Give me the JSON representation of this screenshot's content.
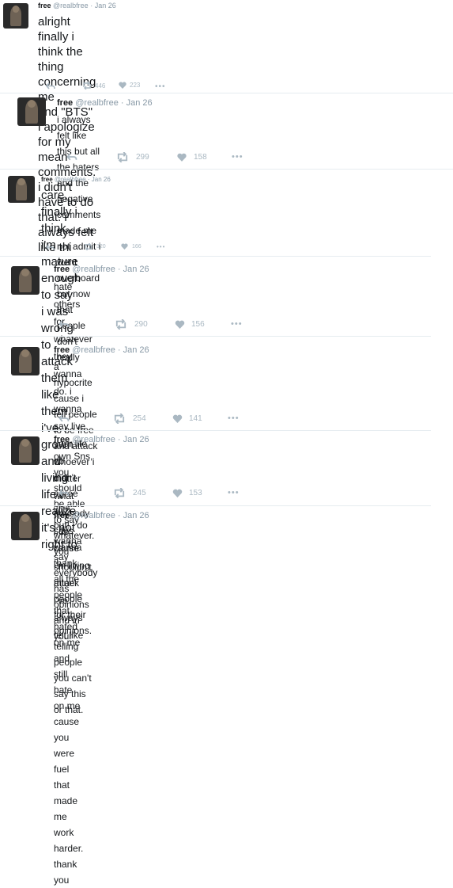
{
  "tweets": [
    {
      "name": "free",
      "handle": "@realbfree",
      "date": "Jan 26",
      "lines": [
        "alright finally i think the thing concerning me",
        "and \"BTS\"",
        "i apologize for my mean comments. i didn't",
        "have to do that. i always felt like thi"
      ],
      "retweets": "446",
      "likes": "223"
    },
    {
      "name": "free",
      "handle": "@realbfree",
      "date": "Jan 26",
      "lines": [
        "i always felt like this but all the haters and the negative comments",
        "made me not admit i went overboard but now that people don't really"
      ],
      "retweets": "299",
      "likes": "158"
    },
    {
      "name": "free",
      "handle": "@realbfree",
      "date": "Jan 26",
      "lines": [
        "care, finally i think i'm mature enough to say",
        "i was wrong to attack them like them. i've",
        "grown and living life i realize it's not right to"
      ],
      "retweets": "320",
      "likes": "166"
    },
    {
      "name": "free",
      "handle": "@realbfree",
      "date": "Jan 26",
      "lines": [
        "hate others for whatever they wanna do. i wanna say live your life no",
        "matter what anybody says cause i'm living mine. i've always felt like"
      ],
      "retweets": "290",
      "likes": "156"
    },
    {
      "name": "free",
      "handle": "@realbfree",
      "date": "Jan 26",
      "lines": [
        "a hypocrite cause i tell people to be free and attack whoever i didn't",
        "agree with.",
        "but! i do wanna say everybody has opinions and in your"
      ],
      "retweets": "254",
      "likes": "141"
    },
    {
      "name": "free",
      "handle": "@realbfree",
      "date": "Jan 26",
      "lines": [
        "own Sns, you should be able to say whatever. you shouldn't attack",
        "people for their opinions. telling people you can't say this or that."
      ],
      "retweets": "245",
      "likes": "153"
    },
    {
      "name": "free",
      "handle": "@realbfree",
      "date": "Jan 26",
      "lines": [
        "i do wanna thank all the people that hated on me and still hate on me",
        "cause you were fuel that made me work harder. thank you"
      ]
    }
  ],
  "colors": {
    "text": "#14171a",
    "meta": "#8899a6",
    "icon": "#aab8c2"
  }
}
